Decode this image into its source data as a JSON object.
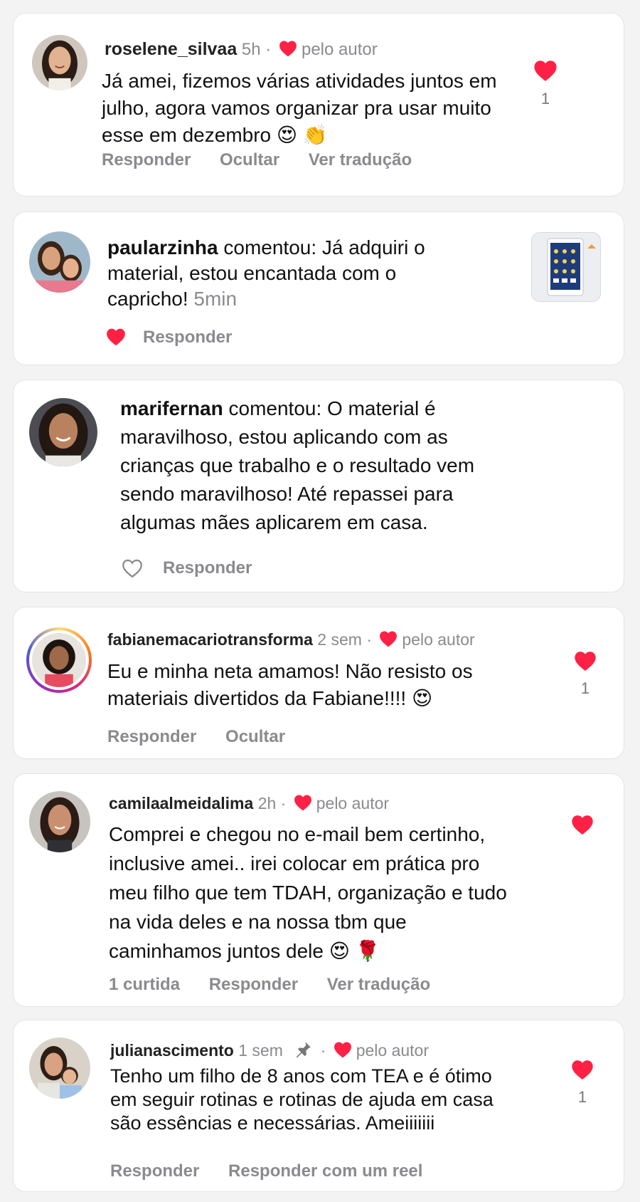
{
  "comments": [
    {
      "username": "roselene_silvaa",
      "time": "5h",
      "author_label": "pelo autor",
      "text": "Já amei, fizemos várias atividades juntos em julho, agora vamos organizar pra usar muito esse em dezembro 😍 👏",
      "actions": [
        "Responder",
        "Ocultar",
        "Ver tradução"
      ],
      "like_count": "1"
    },
    {
      "username": "paularzinha",
      "verb": "comentou:",
      "text": "Já adquiri o material, estou encantada com o capricho!",
      "time": "5min",
      "actions": [
        "Responder"
      ]
    },
    {
      "username": "marifernan",
      "verb": "comentou:",
      "text": "O material é maravilhoso, estou aplicando com as crianças que trabalho e o resultado vem sendo maravilhoso! Até repassei para algumas mães aplicarem em casa.",
      "actions": [
        "Responder"
      ]
    },
    {
      "username": "fabianemacariotransforma",
      "time": "2 sem",
      "author_label": "pelo autor",
      "text": "Eu e minha neta amamos! Não resisto os materiais divertidos da Fabiane!!!! 😍",
      "actions": [
        "Responder",
        "Ocultar"
      ],
      "like_count": "1"
    },
    {
      "username": "camilaalmeidalima",
      "time": "2h",
      "author_label": "pelo autor",
      "text": "Comprei e chegou no e-mail bem certinho, inclusive amei.. irei colocar em prática pro meu filho que tem TDAH, organização e tudo na vida deles e na nossa tbm que caminhamos juntos dele 😍 🌹",
      "actions": [
        "1 curtida",
        "Responder",
        "Ver tradução"
      ]
    },
    {
      "username": "julianascimento",
      "time": "1 sem",
      "author_label": "pelo autor",
      "text": "Tenho um filho de 8 anos com TEA e é ótimo em seguir rotinas e rotinas de ajuda em casa são essências e necessárias. Ameiiiiiii",
      "actions": [
        "Responder",
        "Responder com um reel"
      ],
      "like_count": "1"
    }
  ],
  "icons": {
    "like_filled": "heart-icon",
    "like_outline": "heart-outline-icon",
    "pin": "pin-icon",
    "separator": "·"
  },
  "colors": {
    "heart": "#ff2145",
    "muted": "#8a8a8f"
  }
}
